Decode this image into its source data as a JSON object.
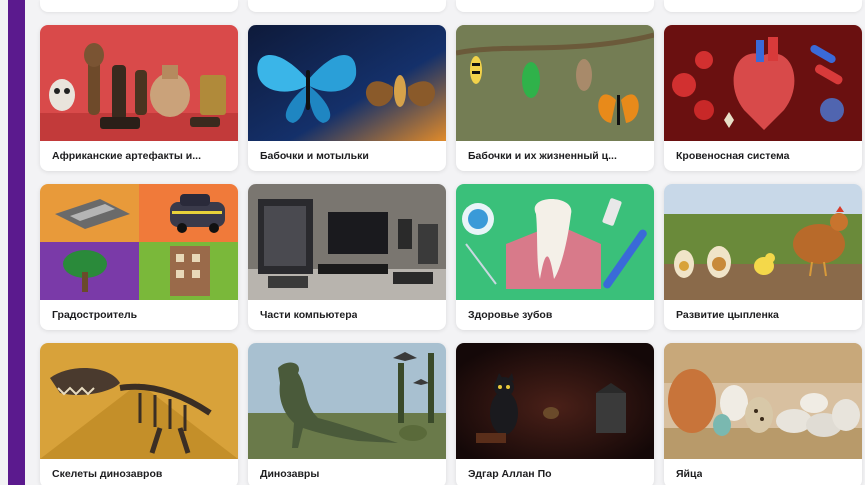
{
  "cards": [
    {
      "title": "Африканские артефакты и...",
      "image": "african-artifacts-image"
    },
    {
      "title": "Бабочки и мотыльки",
      "image": "butterflies-moths-image"
    },
    {
      "title": "Бабочки и их жизненный ц...",
      "image": "butterfly-lifecycle-image"
    },
    {
      "title": "Кровеносная система",
      "image": "circulatory-system-image"
    },
    {
      "title": "Градостроитель",
      "image": "city-builder-image"
    },
    {
      "title": "Части компьютера",
      "image": "computer-parts-image"
    },
    {
      "title": "Здоровье зубов",
      "image": "dental-health-image"
    },
    {
      "title": "Развитие цыпленка",
      "image": "chick-development-image"
    },
    {
      "title": "Скелеты динозавров",
      "image": "dinosaur-skeletons-image"
    },
    {
      "title": "Динозавры",
      "image": "dinosaurs-image"
    },
    {
      "title": "Эдгар Аллан По",
      "image": "edgar-allan-poe-image"
    },
    {
      "title": "Яйца",
      "image": "eggs-image"
    }
  ],
  "colors": {
    "accent": "#5b1a8e",
    "background": "#f3f3f5",
    "card": "#ffffff",
    "text": "#1d1d1f"
  }
}
